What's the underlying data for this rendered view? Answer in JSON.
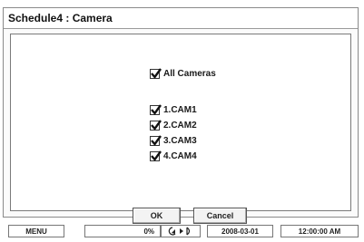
{
  "window": {
    "title": "Schedule4 : Camera"
  },
  "all_cameras": {
    "label": "All Cameras",
    "checked": true
  },
  "cameras": [
    {
      "label": "1.CAM1",
      "checked": true
    },
    {
      "label": "2.CAM2",
      "checked": true
    },
    {
      "label": "3.CAM3",
      "checked": true
    },
    {
      "label": "4.CAM4",
      "checked": true
    }
  ],
  "buttons": {
    "ok": "OK",
    "cancel": "Cancel"
  },
  "statusbar": {
    "menu": "MENU",
    "progress_text": "0%",
    "progress_fraction": 0.0,
    "mode_icon": "rewind-play-icon",
    "date": "2008-03-01",
    "time": "12:00:00 AM"
  }
}
